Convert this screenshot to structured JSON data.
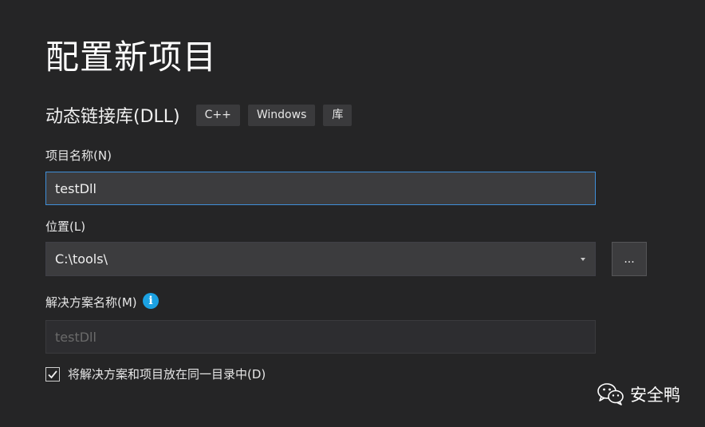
{
  "page": {
    "title": "配置新项目"
  },
  "template": {
    "name": "动态链接库(DLL)",
    "tags": [
      "C++",
      "Windows",
      "库"
    ]
  },
  "project_name": {
    "label": "项目名称(N)",
    "value": "testDll"
  },
  "location": {
    "label": "位置(L)",
    "value": "C:\\tools\\",
    "browse_label": "..."
  },
  "solution_name": {
    "label": "解决方案名称(M)",
    "info_glyph": "i",
    "value": "testDll"
  },
  "same_directory": {
    "label": "将解决方案和项目放在同一目录中(D)",
    "checked": true
  },
  "watermark": {
    "text": "安全鸭"
  },
  "colors": {
    "background": "#252526",
    "input_background": "#3c3c3e",
    "focus_border": "#3f8ed8",
    "info_icon": "#1ba1e2"
  }
}
